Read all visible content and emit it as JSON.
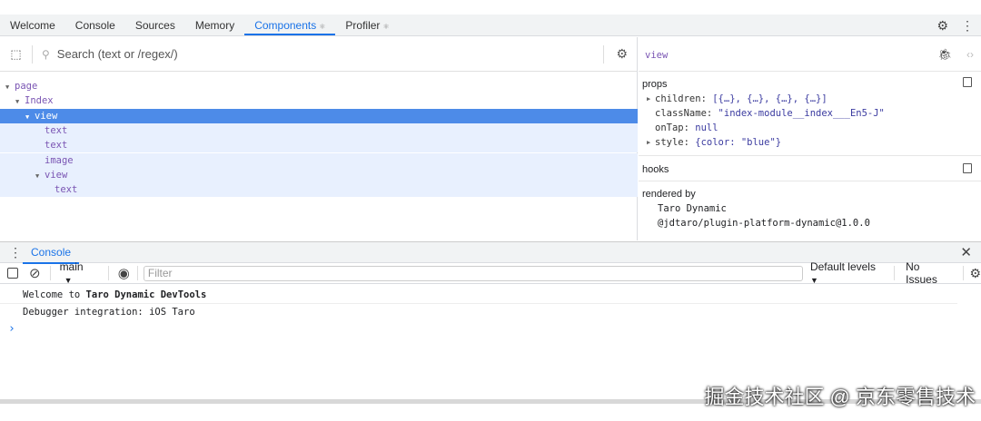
{
  "tabs": [
    {
      "label": "Welcome"
    },
    {
      "label": "Console"
    },
    {
      "label": "Sources"
    },
    {
      "label": "Memory"
    },
    {
      "label": "Components",
      "badge": "⚛",
      "active": true
    },
    {
      "label": "Profiler",
      "badge": "⚛"
    }
  ],
  "components": {
    "search_placeholder": "Search (text or /regex/)",
    "tree": [
      {
        "label": "page",
        "depth": 0,
        "arrow": true
      },
      {
        "label": "Index",
        "depth": 1,
        "arrow": true
      },
      {
        "label": "view",
        "depth": 2,
        "arrow": true,
        "selected": true
      },
      {
        "label": "text",
        "depth": 3
      },
      {
        "label": "text",
        "depth": 3
      },
      {
        "label": "image",
        "depth": 3
      },
      {
        "label": "view",
        "depth": 3,
        "arrow": true
      },
      {
        "label": "text",
        "depth": 4
      }
    ]
  },
  "inspector": {
    "title": "view",
    "props_label": "props",
    "props": [
      {
        "key": "children:",
        "value": "[{…}, {…}, {…}, {…}]",
        "expandable": true
      },
      {
        "key": "className:",
        "value": "\"index-module__index___En5-J\""
      },
      {
        "key": "onTap:",
        "value": "null"
      },
      {
        "key": "style:",
        "value": "{color: \"blue\"}",
        "expandable": true
      }
    ],
    "hooks_label": "hooks",
    "rendered_by_label": "rendered by",
    "rendered_by": [
      "Taro Dynamic",
      "@jdtaro/plugin-platform-dynamic@1.0.0"
    ]
  },
  "console": {
    "tab_label": "Console",
    "context": "main",
    "filter_placeholder": "Filter",
    "levels": "Default levels",
    "issues": "No Issues",
    "messages": [
      {
        "prefix": "Welcome to ",
        "bold": "Taro Dynamic DevTools"
      },
      {
        "prefix": "Debugger integration: iOS Taro",
        "bold": ""
      }
    ],
    "prompt": "›"
  },
  "watermark": "掘金技术社区 @ 京东零售技术"
}
